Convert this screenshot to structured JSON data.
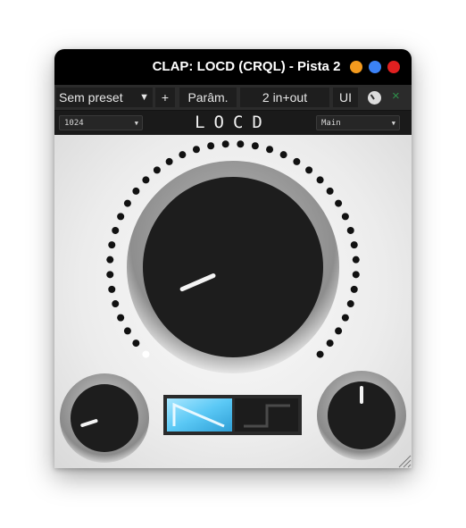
{
  "window": {
    "title": "CLAP: LOCD (CRQL) - Pista 2",
    "buttons": [
      {
        "name": "minimize-button",
        "color": "#f39a1e"
      },
      {
        "name": "maximize-button",
        "color": "#3b82f6"
      },
      {
        "name": "close-button",
        "color": "#e02020"
      }
    ]
  },
  "toolbar": {
    "preset_label": "Sem preset",
    "add_label": "+",
    "params_label": "Parâm.",
    "io_label": "2 in+out",
    "ui_label": "UI",
    "ui_knob_icon": "knob-icon",
    "close_icon": "close-icon"
  },
  "plugin": {
    "left_select_value": "1024",
    "logo": "LOCD",
    "right_select_value": "Main"
  },
  "controls": {
    "main_knob_value": 0.08,
    "left_knob_value": 0.1,
    "right_knob_value": 0.5,
    "mode_selected": 0,
    "mode_icons": [
      "sawtooth-wave-icon",
      "step-wave-icon"
    ],
    "accent_color": "#5ac8f5"
  }
}
